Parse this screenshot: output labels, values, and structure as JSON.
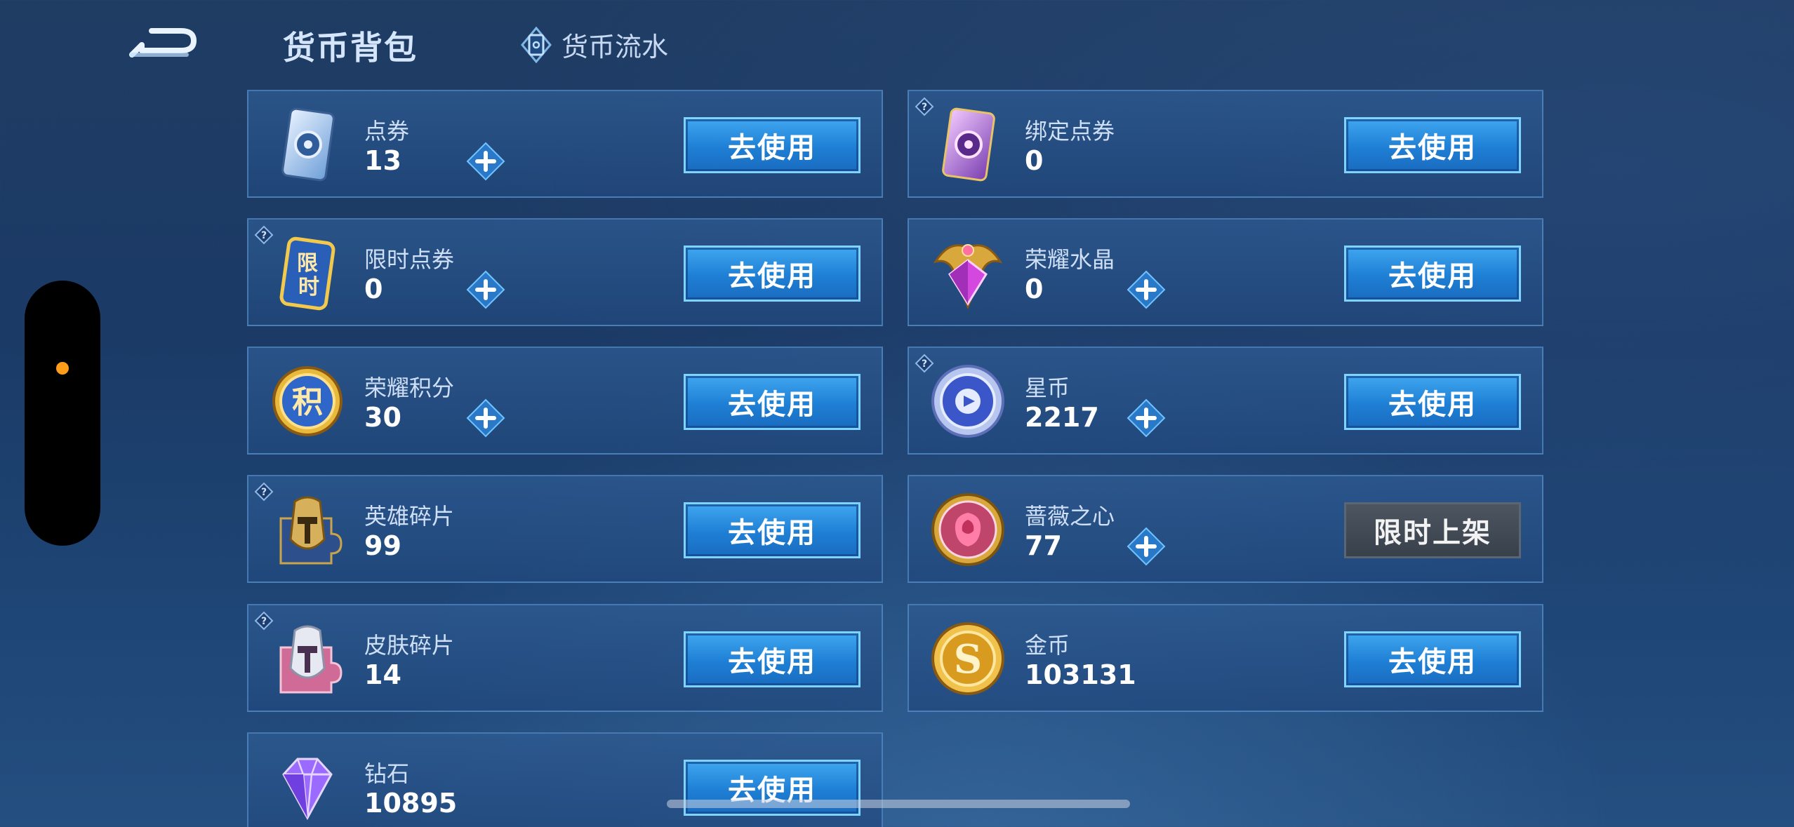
{
  "header": {
    "title": "货币背包",
    "flow_link": "货币流水"
  },
  "currencies": [
    {
      "name": "点券",
      "value": "13",
      "action": "去使用",
      "icon": "voucher-card-icon",
      "help": false,
      "plus": true
    },
    {
      "name": "绑定点券",
      "value": "0",
      "action": "去使用",
      "icon": "bound-voucher-card-icon",
      "help": true,
      "plus": false
    },
    {
      "name": "限时点券",
      "value": "0",
      "action": "去使用",
      "icon": "limited-voucher-icon",
      "icon_text": "限时",
      "help": true,
      "plus": true
    },
    {
      "name": "荣耀水晶",
      "value": "0",
      "action": "去使用",
      "icon": "glory-crystal-icon",
      "help": false,
      "plus": true
    },
    {
      "name": "荣耀积分",
      "value": "30",
      "action": "去使用",
      "icon": "glory-points-icon",
      "icon_text": "积",
      "help": false,
      "plus": true
    },
    {
      "name": "星币",
      "value": "2217",
      "action": "去使用",
      "icon": "star-coin-icon",
      "help": true,
      "plus": true
    },
    {
      "name": "英雄碎片",
      "value": "99",
      "action": "去使用",
      "icon": "hero-fragment-icon",
      "help": true,
      "plus": false
    },
    {
      "name": "蔷薇之心",
      "value": "77",
      "action": "限时上架",
      "icon": "rose-heart-icon",
      "help": false,
      "plus": true,
      "action_disabled": true
    },
    {
      "name": "皮肤碎片",
      "value": "14",
      "action": "去使用",
      "icon": "skin-fragment-icon",
      "help": true,
      "plus": false
    },
    {
      "name": "金币",
      "value": "103131",
      "action": "去使用",
      "icon": "gold-coin-icon",
      "icon_text": "S",
      "help": false,
      "plus": false
    },
    {
      "name": "钻石",
      "value": "10895",
      "action": "去使用",
      "icon": "diamond-icon",
      "help": false,
      "plus": false
    }
  ],
  "colors": {
    "accent_button": "#1e7fd4",
    "disabled_button": "#444c57",
    "notch_dot": "#ff9c1a"
  }
}
